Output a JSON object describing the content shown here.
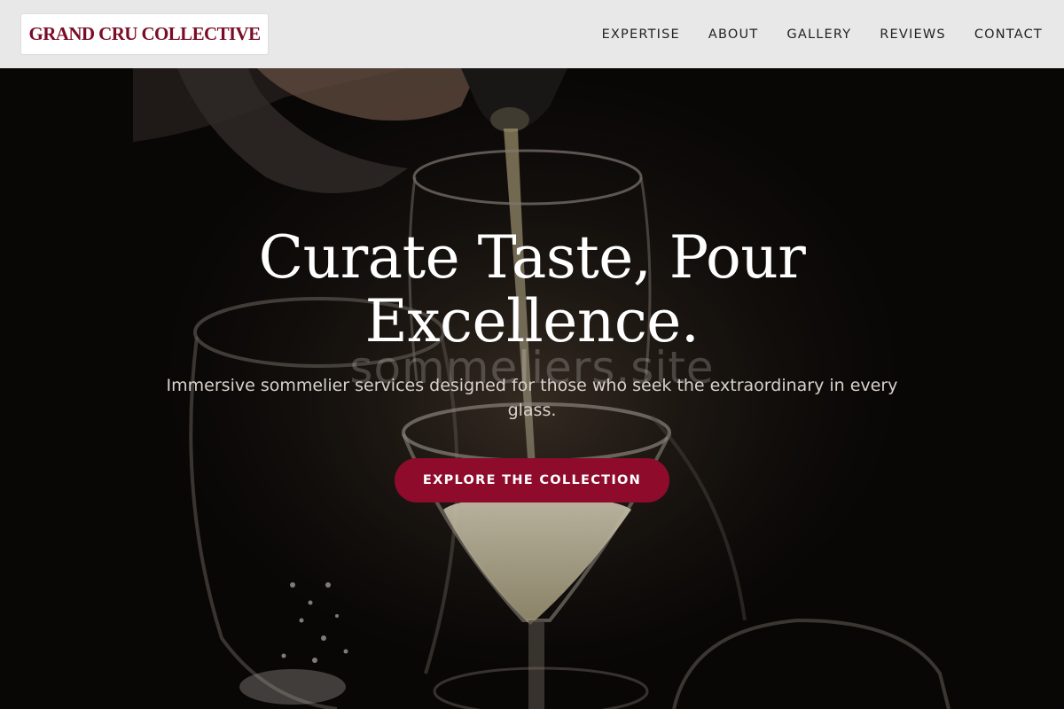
{
  "brand": {
    "logo_text": "GRAND CRU COLLECTIVE",
    "logo_color": "#7a0c26"
  },
  "nav": {
    "items": [
      {
        "label": "EXPERTISE"
      },
      {
        "label": "ABOUT"
      },
      {
        "label": "GALLERY"
      },
      {
        "label": "REVIEWS"
      },
      {
        "label": "CONTACT"
      }
    ]
  },
  "hero": {
    "headline": "Curate Taste, Pour Excellence.",
    "watermark": "sommeliers.site",
    "subhead": "Immersive sommelier services designed for those who seek the extraordinary in every glass.",
    "cta_label": "EXPLORE THE COLLECTION",
    "cta_color": "#8e0b2c"
  }
}
